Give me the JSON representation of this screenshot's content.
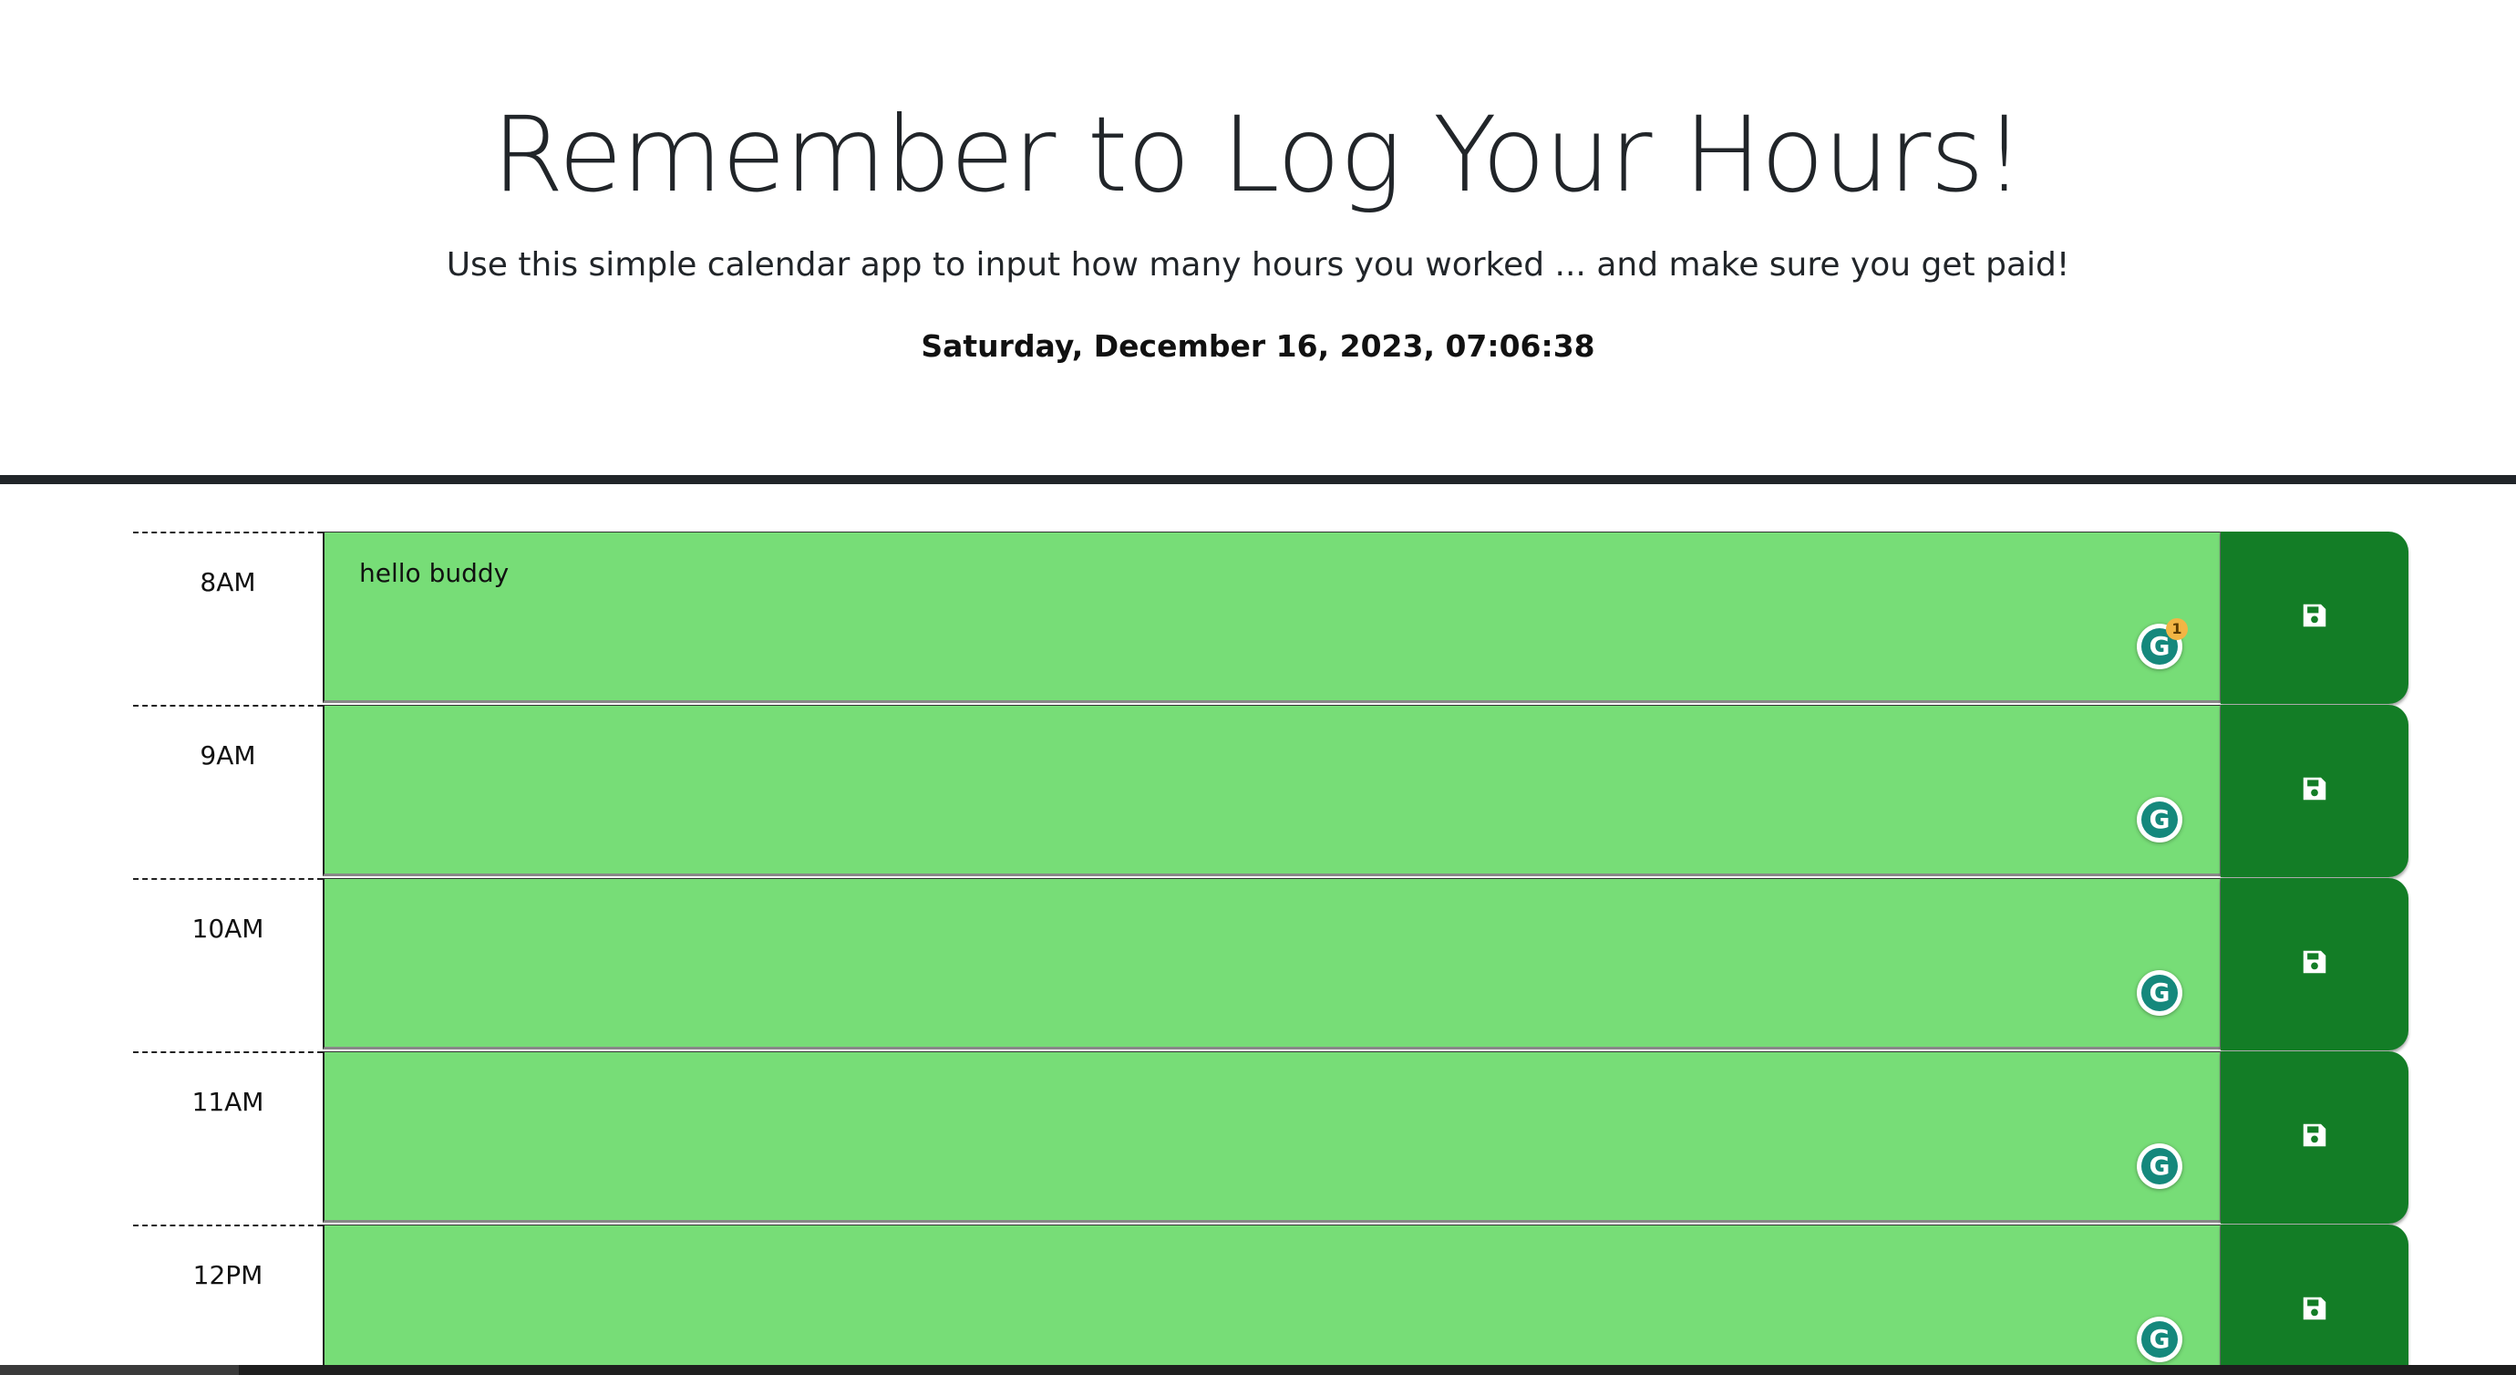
{
  "header": {
    "title": "Remember to Log Your Hours!",
    "subtitle": "Use this simple calendar app to input how many hours you worked ... and make sure you get paid!",
    "datetime": "Saturday, December 16, 2023, 07:06:38"
  },
  "rows": [
    {
      "hour": "8AM",
      "text": "hello buddy",
      "grammarly_badge": "1"
    },
    {
      "hour": "9AM",
      "text": ""
    },
    {
      "hour": "10AM",
      "text": ""
    },
    {
      "hour": "11AM",
      "text": ""
    },
    {
      "hour": "12PM",
      "text": ""
    }
  ],
  "colors": {
    "present_row": "#77dd77",
    "save_button": "#137d26",
    "divider": "#212529",
    "grammarly": "#15887c"
  },
  "icons": {
    "save": "floppy-disk-icon",
    "grammarly": "grammarly-icon"
  }
}
